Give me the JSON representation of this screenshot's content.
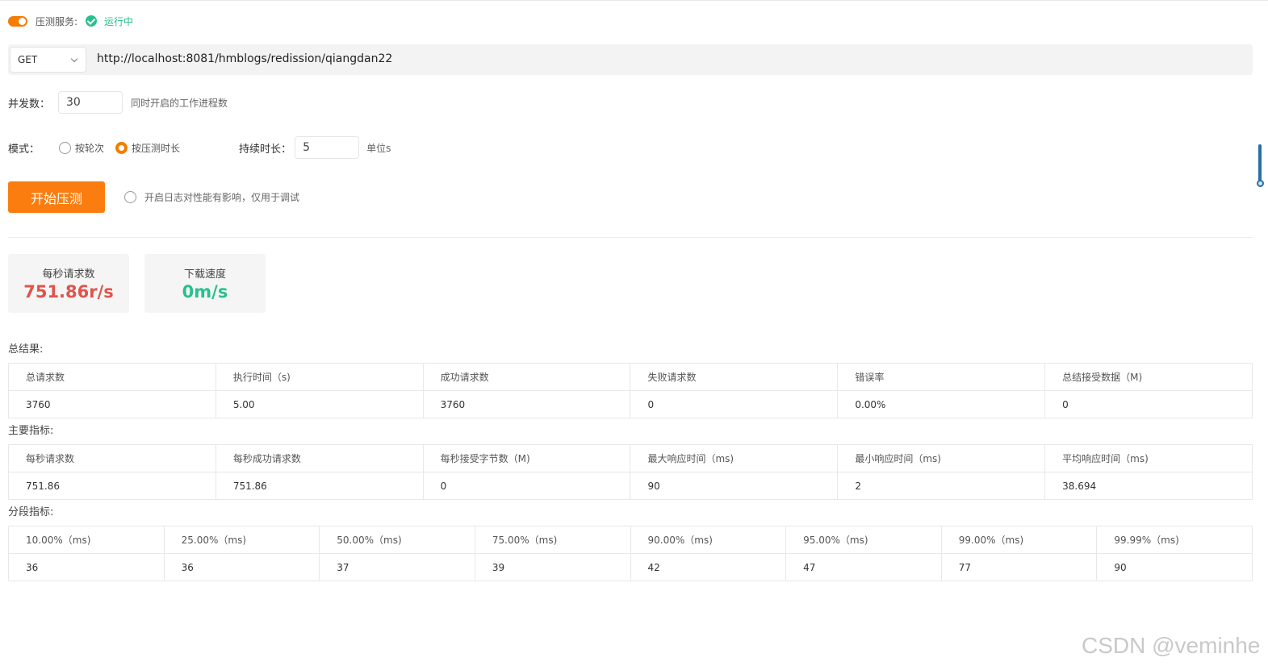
{
  "service": {
    "label": "压测服务:",
    "status": "运行中",
    "enabled": true
  },
  "request": {
    "method": "GET",
    "url": "http://localhost:8081/hmblogs/redission/qiangdan22"
  },
  "concurrency": {
    "label": "并发数：",
    "value": "30",
    "hint": "同时开启的工作进程数"
  },
  "mode": {
    "label": "模式：",
    "options": [
      "按轮次",
      "按压测时长"
    ],
    "selected": "按压测时长",
    "duration_label": "持续时长：",
    "duration_value": "5",
    "duration_unit": "单位s"
  },
  "actions": {
    "start_label": "开始压测",
    "log_label": "开启日志对性能有影响，仅用于调试"
  },
  "stats": {
    "rps_label": "每秒请求数",
    "rps_value": "751.86r/s",
    "download_label": "下载速度",
    "download_value": "0m/s"
  },
  "colors": {
    "accent": "#fb7d10",
    "success": "#27c08e",
    "danger": "#e0534c"
  },
  "summary": {
    "title": "总结果:",
    "headers": [
      "总请求数",
      "执行时间（s)",
      "成功请求数",
      "失败请求数",
      "错误率",
      "总结接受数据（M)"
    ],
    "values": [
      "3760",
      "5.00",
      "3760",
      "0",
      "0.00%",
      "0"
    ]
  },
  "metrics": {
    "title": "主要指标:",
    "headers": [
      "每秒请求数",
      "每秒成功请求数",
      "每秒接受字节数（M)",
      "最大响应时间（ms)",
      "最小响应时间（ms)",
      "平均响应时间（ms)"
    ],
    "values": [
      "751.86",
      "751.86",
      "0",
      "90",
      "2",
      "38.694"
    ]
  },
  "percentiles": {
    "title": "分段指标:",
    "headers": [
      "10.00%（ms)",
      "25.00%（ms)",
      "50.00%（ms)",
      "75.00%（ms)",
      "90.00%（ms)",
      "95.00%（ms)",
      "99.00%（ms)",
      "99.99%（ms)"
    ],
    "values": [
      "36",
      "36",
      "37",
      "39",
      "42",
      "47",
      "77",
      "90"
    ]
  },
  "watermark": "CSDN @veminhe"
}
